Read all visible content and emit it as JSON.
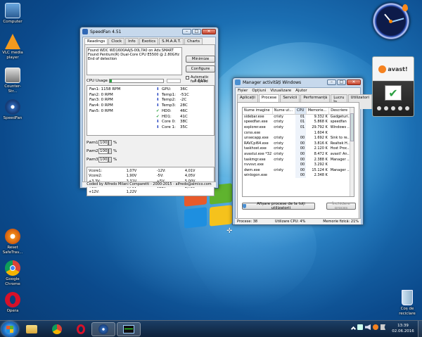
{
  "desktop_icons": [
    {
      "label": "Computer"
    },
    {
      "label": "VLC media player"
    },
    {
      "label": "Counter-Str..."
    },
    {
      "label": "SpeedFan"
    },
    {
      "label": "Reset SafeTrav..."
    },
    {
      "label": "Google Chrome"
    },
    {
      "label": "Opera"
    }
  ],
  "recycle_bin": {
    "label": "Coș de reciclare"
  },
  "speedfan": {
    "title": "SpeedFan 4.51",
    "tabs": [
      "Readings",
      "Clock",
      "Info",
      "Exotics",
      "S.M.A.R.T.",
      "Charts"
    ],
    "log": [
      "Found WDC WD1600AAJS-00L7A0 on Adv.SMART",
      "Found Pentium(R) Dual-Core CPU E5500 @ 2.80GHz",
      "End of detection"
    ],
    "minimize_label": "Minimize",
    "configure_label": "Configure",
    "auto_fan_label": "Automatic fan speed",
    "cpu_usage_label": "CPU Usage",
    "cpu_usage_value": "3.61%",
    "cpu_usage_fraction": 0.036,
    "fans": [
      "Fan1: 1158 RPM",
      "Fan2: 0 RPM",
      "Fan3: 0 RPM",
      "Fan4: 0 RPM",
      "Fan5: 0 RPM"
    ],
    "temps": [
      {
        "name": "GPU:",
        "value": "36C",
        "icon": "arrow-down-icon"
      },
      {
        "name": "Temp1:",
        "value": "-51C",
        "icon": "arrow-down-icon"
      },
      {
        "name": "Temp2:",
        "value": "-2C",
        "icon": "arrow-down-icon"
      },
      {
        "name": "Temp3:",
        "value": "28C",
        "icon": "arrow-down-icon"
      },
      {
        "name": "HD0:",
        "value": "46C",
        "icon": "check-icon"
      },
      {
        "name": "HD1:",
        "value": "41C",
        "icon": "check-icon"
      },
      {
        "name": "Core 0:",
        "value": "38C",
        "icon": "arrow-down-icon"
      },
      {
        "name": "Core 1:",
        "value": "35C",
        "icon": "arrow-down-icon"
      }
    ],
    "pwms": [
      {
        "label": "Pwm1:",
        "value": "100",
        "unit": "%"
      },
      {
        "label": "Pwm2:",
        "value": "100",
        "unit": "%"
      },
      {
        "label": "Pwm3:",
        "value": "100",
        "unit": "%"
      }
    ],
    "voltages": [
      [
        "Vcore1:",
        "1,07V",
        "-12V:",
        "4,01V"
      ],
      [
        "Vcore2:",
        "1,90V",
        "-5V:",
        "4,05V"
      ],
      [
        "+3.3V:",
        "3,31V",
        "+5V:",
        "5,00V"
      ],
      [
        "+5V:",
        "4,70V",
        "Vbat:",
        "2,78V"
      ],
      [
        "+12V:",
        "1,22V",
        "",
        ""
      ]
    ],
    "footer": "Coded by Alfredo Milani Comparetti - 2000-2015 - alfredo@almico.com"
  },
  "taskmgr": {
    "title": "Manager activități Windows",
    "menu": [
      "Fișier",
      "Opțiuni",
      "Vizualizare",
      "Ajutor"
    ],
    "tabs": [
      "Aplicații",
      "Procese",
      "Servicii",
      "Performanță",
      "Lucru în rețea",
      "Utilizatori"
    ],
    "active_tab": 1,
    "columns": [
      "Nume imagine",
      "Nume ut...",
      "CPU",
      "Memorie...",
      "Descriere"
    ],
    "rows": [
      [
        "sidebar.exe",
        "cristy",
        "01",
        "9.332 K",
        "Gadgeturi..."
      ],
      [
        "speedfan.exe",
        "cristy",
        "01",
        "5.868 K",
        "speedfan"
      ],
      [
        "explorer.exe",
        "cristy",
        "01",
        "29.792 K",
        "Windows ..."
      ],
      [
        "csrss.exe",
        "",
        "",
        "1.604 K",
        ""
      ],
      [
        "unsecapp.exe",
        "cristy",
        "00",
        "1.692 K",
        "Sink to re..."
      ],
      [
        "RAVCpl64.exe",
        "cristy",
        "00",
        "3.816 K",
        "Realtek H..."
      ],
      [
        "taskhost.exe",
        "cristy",
        "00",
        "2.120 K",
        "Host Proc..."
      ],
      [
        "avastui.exe *32",
        "cristy",
        "00",
        "8.472 K",
        "avast! An..."
      ],
      [
        "taskmgr.exe",
        "cristy",
        "00",
        "2.388 K",
        "Manager ..."
      ],
      [
        "nvvsvc.exe",
        "",
        "00",
        "3.292 K",
        ""
      ],
      [
        "dwm.exe",
        "cristy",
        "00",
        "15.124 K",
        "Manager ..."
      ],
      [
        "winlogon.exe",
        "",
        "00",
        "2.348 K",
        ""
      ]
    ],
    "show_all_label": "Afișare procese de la toți utilizatorii",
    "end_process_label": "Închidere proces",
    "status": {
      "processes": "Procese: 38",
      "cpu": "Utilizare CPU: 4%",
      "memory": "Memorie fizică: 21%"
    }
  },
  "avast_widget": {
    "brand": "avast!"
  },
  "tray": {
    "time": "13:39",
    "date": "02.06.2016"
  }
}
